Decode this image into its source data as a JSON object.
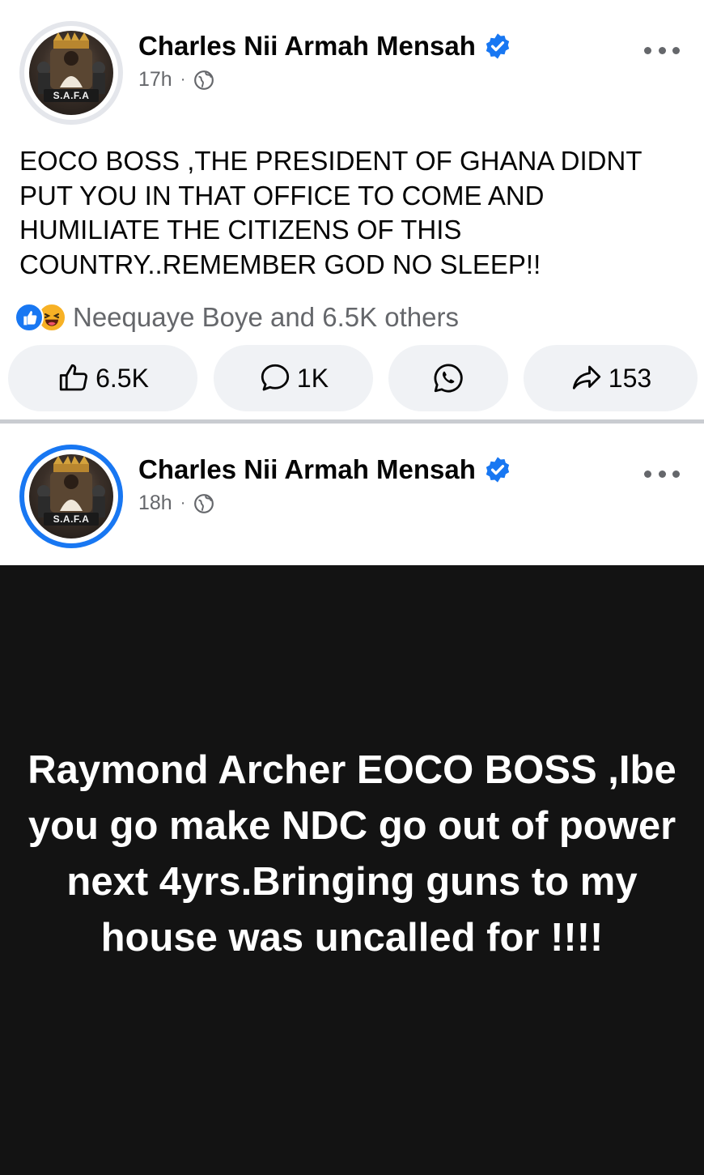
{
  "posts": [
    {
      "author": "Charles Nii Armah Mensah",
      "time": "17h",
      "avatar_label": "S.A.F.A",
      "text": "EOCO BOSS ,THE PRESIDENT OF GHANA DIDNT PUT YOU IN THAT OFFICE TO COME AND HUMILIATE THE CITIZENS OF THIS COUNTRY..REMEMBER GOD NO SLEEP!!",
      "reactions_text": "Neequaye Boye and 6.5K others",
      "likes": "6.5K",
      "comments": "1K",
      "shares": "153"
    },
    {
      "author": "Charles Nii Armah Mensah",
      "time": "18h",
      "avatar_label": "S.A.F.A",
      "image_text": "Raymond Archer EOCO BOSS ,Ibe you go make NDC go out of power next 4yrs.Bringing guns to my house was uncalled for !!!!"
    }
  ],
  "colors": {
    "accent": "#1877f2",
    "secondary_text": "#65676b",
    "button_bg": "#f0f2f5",
    "image_bg": "#131313"
  },
  "icons": [
    "verified-badge-icon",
    "globe-icon",
    "more-options-icon",
    "like-reaction-icon",
    "haha-reaction-icon",
    "thumbs-up-icon",
    "comment-icon",
    "whatsapp-icon",
    "share-icon"
  ]
}
